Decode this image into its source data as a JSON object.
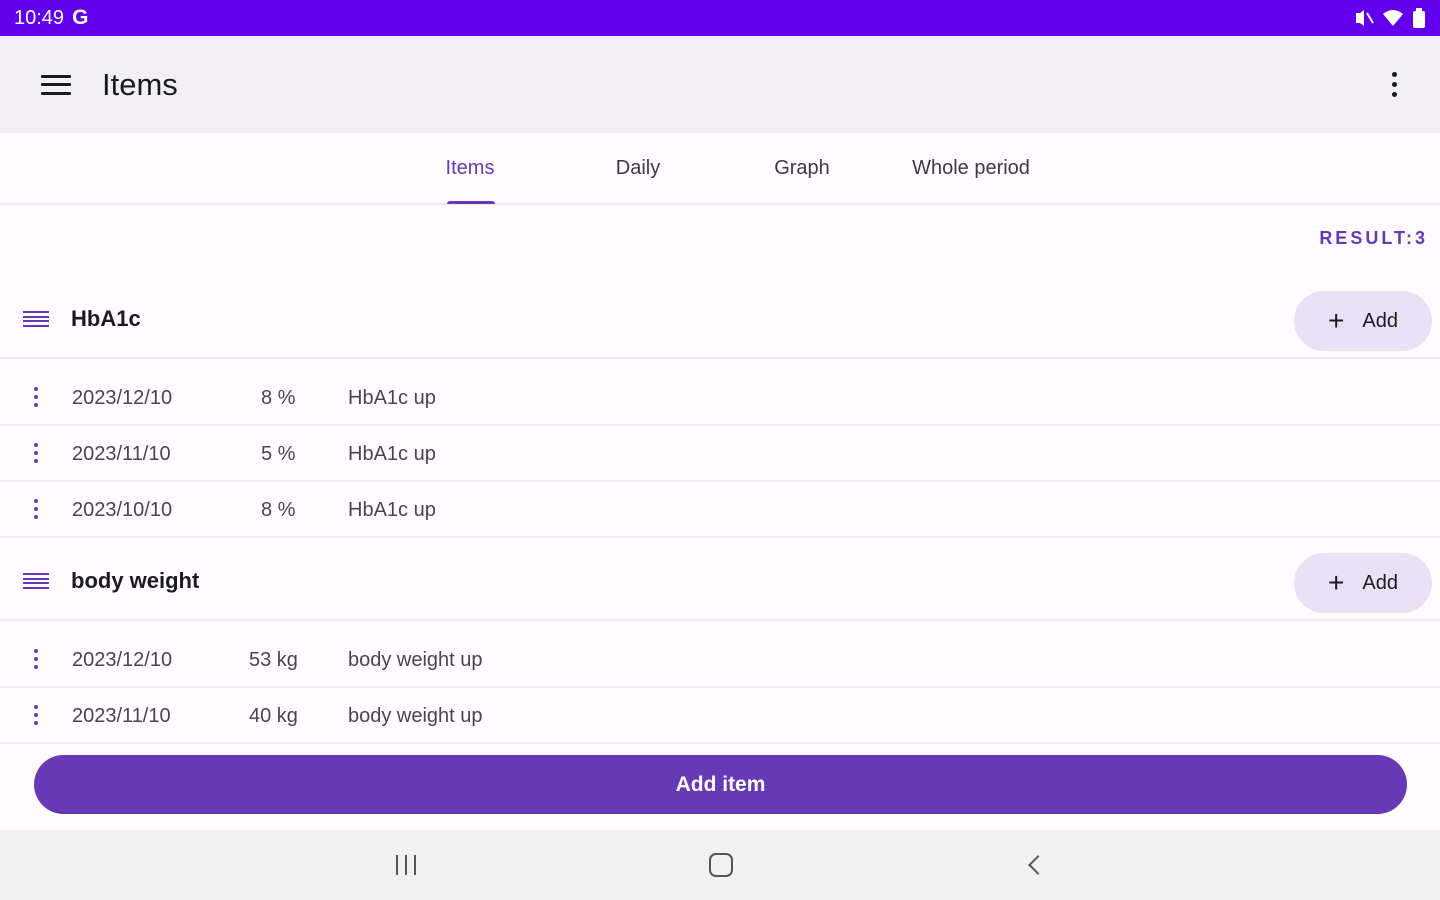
{
  "status_bar": {
    "time": "10:49",
    "carrier_glyph": "G",
    "icons": [
      "mute-icon",
      "wifi-icon",
      "battery-icon"
    ]
  },
  "app_bar": {
    "title": "Items",
    "menu_icon": "hamburger-icon",
    "overflow_icon": "more-vert-icon"
  },
  "tabs": [
    {
      "label": "Items",
      "active": true
    },
    {
      "label": "Daily",
      "active": false
    },
    {
      "label": "Graph",
      "active": false
    },
    {
      "label": "Whole period",
      "active": false
    }
  ],
  "result_label": "RESULT:3",
  "groups": [
    {
      "name": "HbA1c",
      "add_label": "Add",
      "rows": [
        {
          "date": "2023/12/10",
          "value": "8 %",
          "note": "HbA1c up"
        },
        {
          "date": "2023/11/10",
          "value": "5 %",
          "note": "HbA1c up"
        },
        {
          "date": "2023/10/10",
          "value": "8 %",
          "note": "HbA1c up"
        }
      ]
    },
    {
      "name": "body weight",
      "add_label": "Add",
      "rows": [
        {
          "date": "2023/12/10",
          "value": "53 kg",
          "note": "body weight up"
        },
        {
          "date": "2023/11/10",
          "value": "40 kg",
          "note": "body weight up"
        }
      ]
    }
  ],
  "add_item_label": "Add item",
  "colors": {
    "status_bar": "#6200ee",
    "accent": "#6739b7",
    "app_bar_bg": "#f3eff6",
    "add_chip_bg": "#e9e0f6"
  }
}
